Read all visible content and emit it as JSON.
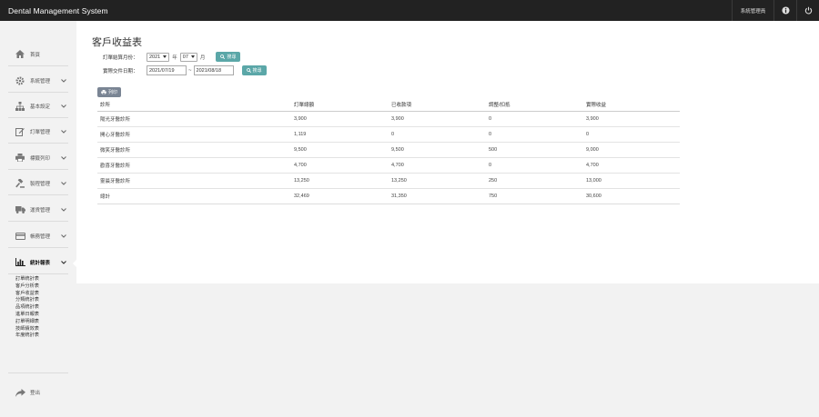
{
  "app": {
    "title": "Dental Management System"
  },
  "topbar": {
    "user_label": "系統管理員"
  },
  "sidebar": {
    "items": [
      {
        "label": "首頁"
      },
      {
        "label": "系統管理"
      },
      {
        "label": "基本設定"
      },
      {
        "label": "訂單管理"
      },
      {
        "label": "標籤列印"
      },
      {
        "label": "製程管理"
      },
      {
        "label": "運貨管理"
      },
      {
        "label": "帳務管理"
      },
      {
        "label": "統計報表"
      }
    ],
    "sub_items": [
      "訂單統計表",
      "客戶分析表",
      "客戶收益表",
      "分類統計表",
      "品項統計表",
      "進單日報表",
      "訂單明細表",
      "技師績效表",
      "年度統計表"
    ],
    "logout_label": "登出"
  },
  "page": {
    "title": "客戶收益表",
    "filter1": {
      "label": "訂單結算月份：",
      "year": "2021",
      "year_unit": "年",
      "month": "07",
      "month_unit": "月",
      "search_label": "搜尋"
    },
    "filter2": {
      "label": "實際交件日期：",
      "date_from": "2021/07/19",
      "separator": "~",
      "date_to": "2021/08/18",
      "search_label": "搜尋"
    },
    "print_label": "列印"
  },
  "table": {
    "headers": [
      "診所",
      "訂單總額",
      "已收款項",
      "調整/扣抵",
      "實際收益"
    ],
    "rows": [
      [
        "陽光牙醫診所",
        "3,900",
        "3,900",
        "0",
        "3,900"
      ],
      [
        "開心牙醫診所",
        "1,119",
        "0",
        "0",
        "0"
      ],
      [
        "微笑牙醫診所",
        "9,500",
        "9,500",
        "500",
        "9,000"
      ],
      [
        "歡喜牙醫診所",
        "4,700",
        "4,700",
        "0",
        "4,700"
      ],
      [
        "靈晨牙醫診所",
        "13,250",
        "13,250",
        "250",
        "13,000"
      ],
      [
        "總計",
        "32,469",
        "31,350",
        "750",
        "30,600"
      ]
    ]
  },
  "colors": {
    "topbar_bg": "#222222",
    "search_btn": "#5ba7a8",
    "print_btn": "#7a8594"
  }
}
